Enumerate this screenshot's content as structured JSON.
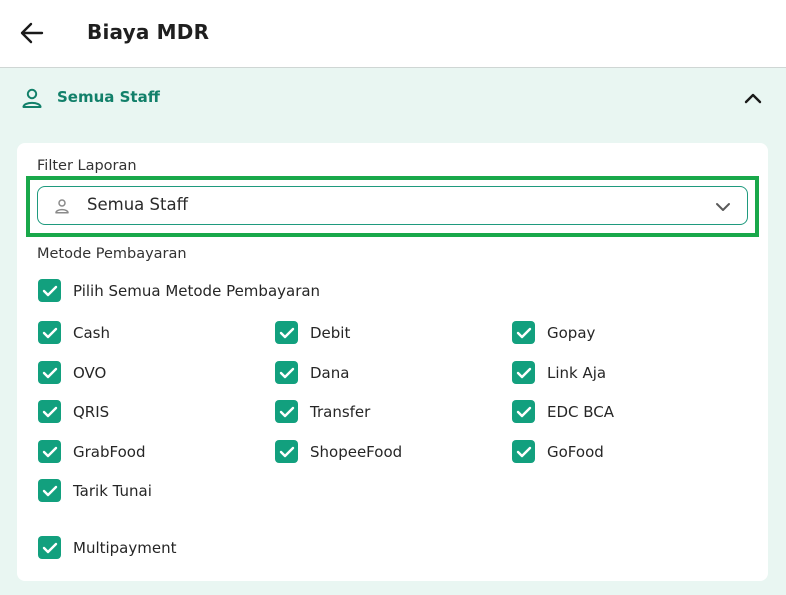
{
  "header": {
    "title": "Biaya MDR"
  },
  "staff_section": {
    "label": "Semua Staff"
  },
  "filter": {
    "label": "Filter Laporan",
    "selected": "Semua Staff"
  },
  "payment": {
    "label": "Metode Pembayaran",
    "select_all": {
      "label": "Pilih Semua Metode Pembayaran",
      "checked": true
    },
    "methods": [
      {
        "label": "Cash",
        "checked": true
      },
      {
        "label": "Debit",
        "checked": true
      },
      {
        "label": "Gopay",
        "checked": true
      },
      {
        "label": "OVO",
        "checked": true
      },
      {
        "label": "Dana",
        "checked": true
      },
      {
        "label": "Link Aja",
        "checked": true
      },
      {
        "label": "QRIS",
        "checked": true
      },
      {
        "label": "Transfer",
        "checked": true
      },
      {
        "label": "EDC BCA",
        "checked": true
      },
      {
        "label": "GrabFood",
        "checked": true
      },
      {
        "label": "ShopeeFood",
        "checked": true
      },
      {
        "label": "GoFood",
        "checked": true
      },
      {
        "label": "Tarik Tunai",
        "checked": true
      }
    ],
    "multipayment": {
      "label": "Multipayment",
      "checked": true
    }
  },
  "colors": {
    "accent": "#12a07e",
    "accent_text": "#12806a",
    "highlight": "#19a84a",
    "background": "#e9f6f2"
  },
  "icons": {
    "back": "arrow-left-icon",
    "staff": "person-icon",
    "collapse": "chevron-up-icon",
    "dropdown": "chevron-down-icon",
    "check": "checkmark-icon"
  }
}
